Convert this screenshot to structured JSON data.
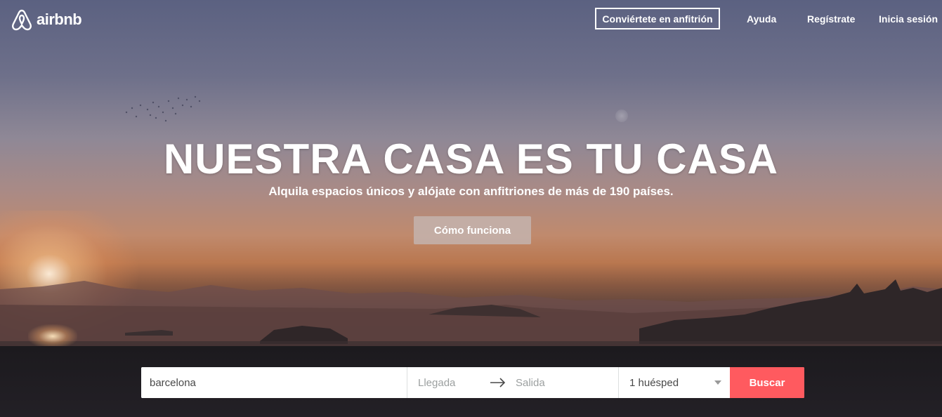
{
  "header": {
    "logo_text": "airbnb",
    "host_button": "Conviértete en anfitrión",
    "help_link": "Ayuda",
    "signup_link": "Regístrate",
    "login_link": "Inicia sesión"
  },
  "hero": {
    "headline": "NUESTRA CASA ES TU CASA",
    "subheadline": "Alquila espacios únicos y alójate con anfitriones de más de 190 países.",
    "how_button": "Cómo funciona"
  },
  "search": {
    "location_value": "barcelona",
    "checkin_placeholder": "Llegada",
    "checkout_placeholder": "Salida",
    "guests_value": "1 huésped",
    "submit_label": "Buscar"
  },
  "colors": {
    "brand": "#ff5a5f",
    "text_dark": "#484848",
    "placeholder": "#9ca0a0"
  },
  "icons": {
    "logo": "airbnb-belo-icon",
    "arrow": "arrow-right-icon",
    "caret": "chevron-down-icon"
  }
}
